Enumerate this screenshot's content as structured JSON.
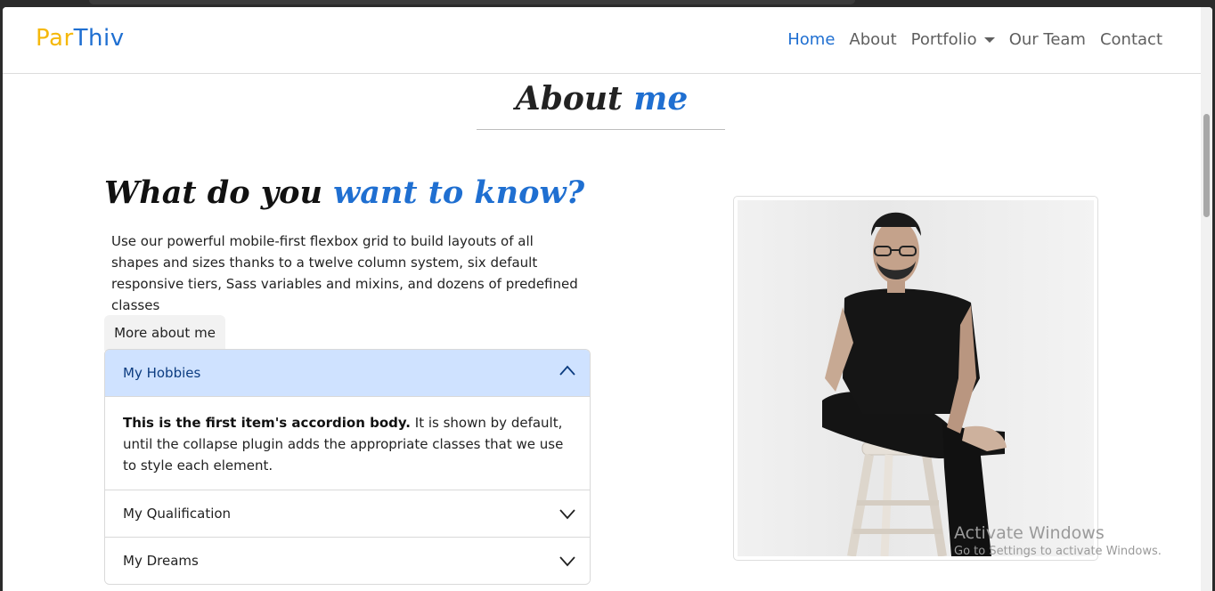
{
  "brand": {
    "part1": "Par",
    "part2": "T",
    "part3": "hiv"
  },
  "nav": {
    "home": "Home",
    "about": "About",
    "portfolio": "Portfolio",
    "team": "Our Team",
    "contact": "Contact"
  },
  "about": {
    "title_plain": "About",
    "title_accent": "me"
  },
  "intro": {
    "title_plain": "What do you",
    "title_accent": "want to know?",
    "description": "Use our powerful mobile-first flexbox grid to build layouts of all shapes and sizes thanks to a twelve column system, six default responsive tiers, Sass variables and mixins, and dozens of predefined classes"
  },
  "more_button": "More about me",
  "accordion": {
    "items": [
      {
        "label": "My Hobbies",
        "expanded": true
      },
      {
        "label": "My Qualification",
        "expanded": false
      },
      {
        "label": "My Dreams",
        "expanded": false
      }
    ],
    "body_bold": "This is the first item's accordion body.",
    "body_text": " It is shown by default, until the collapse plugin adds the appropriate classes that we use to style each element."
  },
  "watermark": {
    "line1": "Activate Windows",
    "line2": "Go to Settings to activate Windows."
  },
  "colors": {
    "accent": "#1f6fd1",
    "brand_yellow": "#f5b80b",
    "accordion_active": "#cfe2ff"
  }
}
